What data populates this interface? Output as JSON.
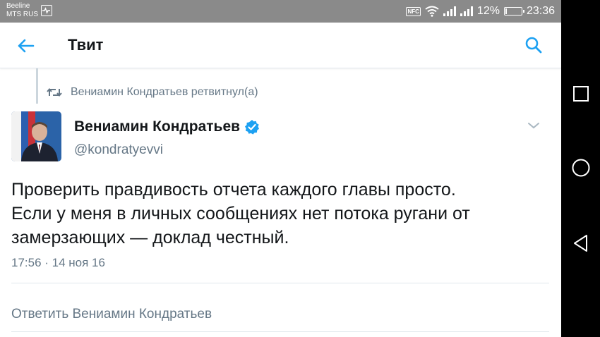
{
  "status_bar": {
    "carrier_1": "Beeline",
    "carrier_2": "MTS RUS",
    "nfc_label": "NFC",
    "battery_percent": "12%",
    "battery_level": 0.12,
    "time": "23:36"
  },
  "toolbar": {
    "title": "Твит",
    "back_icon": "arrow-left-icon",
    "search_icon": "search-icon"
  },
  "retweet": {
    "icon": "retweet-icon",
    "text": "Вениамин Кондратьев ретвитнул(а)"
  },
  "tweet": {
    "author_name": "Вениамин Кондратьев",
    "author_handle": "@kondratyevvi",
    "text_lines": [
      "Проверить правдивость отчета каждого главы просто.",
      "Если у меня в личных сообщениях нет потока ругани от",
      "замерзающих — доклад честный."
    ],
    "timestamp": "17:56 · 14 ноя 16"
  },
  "reply": {
    "placeholder": "Ответить Вениамин Кондратьев"
  },
  "colors": {
    "accent": "#1da1f2",
    "status_bar": "#8a8a8a",
    "secondary_text": "#657786"
  }
}
